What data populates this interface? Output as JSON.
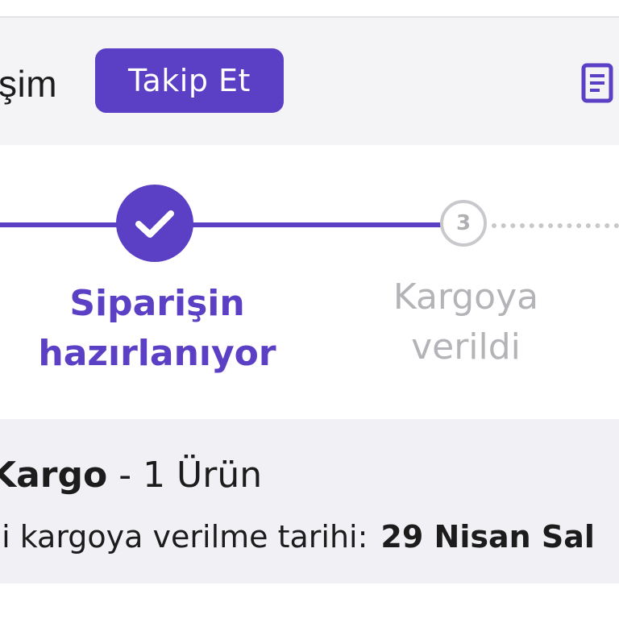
{
  "header": {
    "title": "şim",
    "follow_button": "Takip Et",
    "document_icon": "document-icon"
  },
  "stepper": {
    "steps": [
      {
        "label_line1": "Siparişin",
        "label_line2": "hazırlanıyor",
        "status": "completed",
        "icon": "check-icon"
      },
      {
        "number": "3",
        "label_line1": "Kargoya",
        "label_line2": "verildi",
        "status": "pending"
      }
    ]
  },
  "cargo": {
    "name": "Kargo",
    "separator": " - ",
    "count": "1 Ürün",
    "date_label": "hi kargoya verilme tarihi:",
    "date_value": "29 Nisan Sal"
  },
  "colors": {
    "accent": "#5b3fc4",
    "header_bg": "#f4f4f6",
    "panel_bg": "#f0f0f5",
    "pending": "#b4b4b8"
  }
}
